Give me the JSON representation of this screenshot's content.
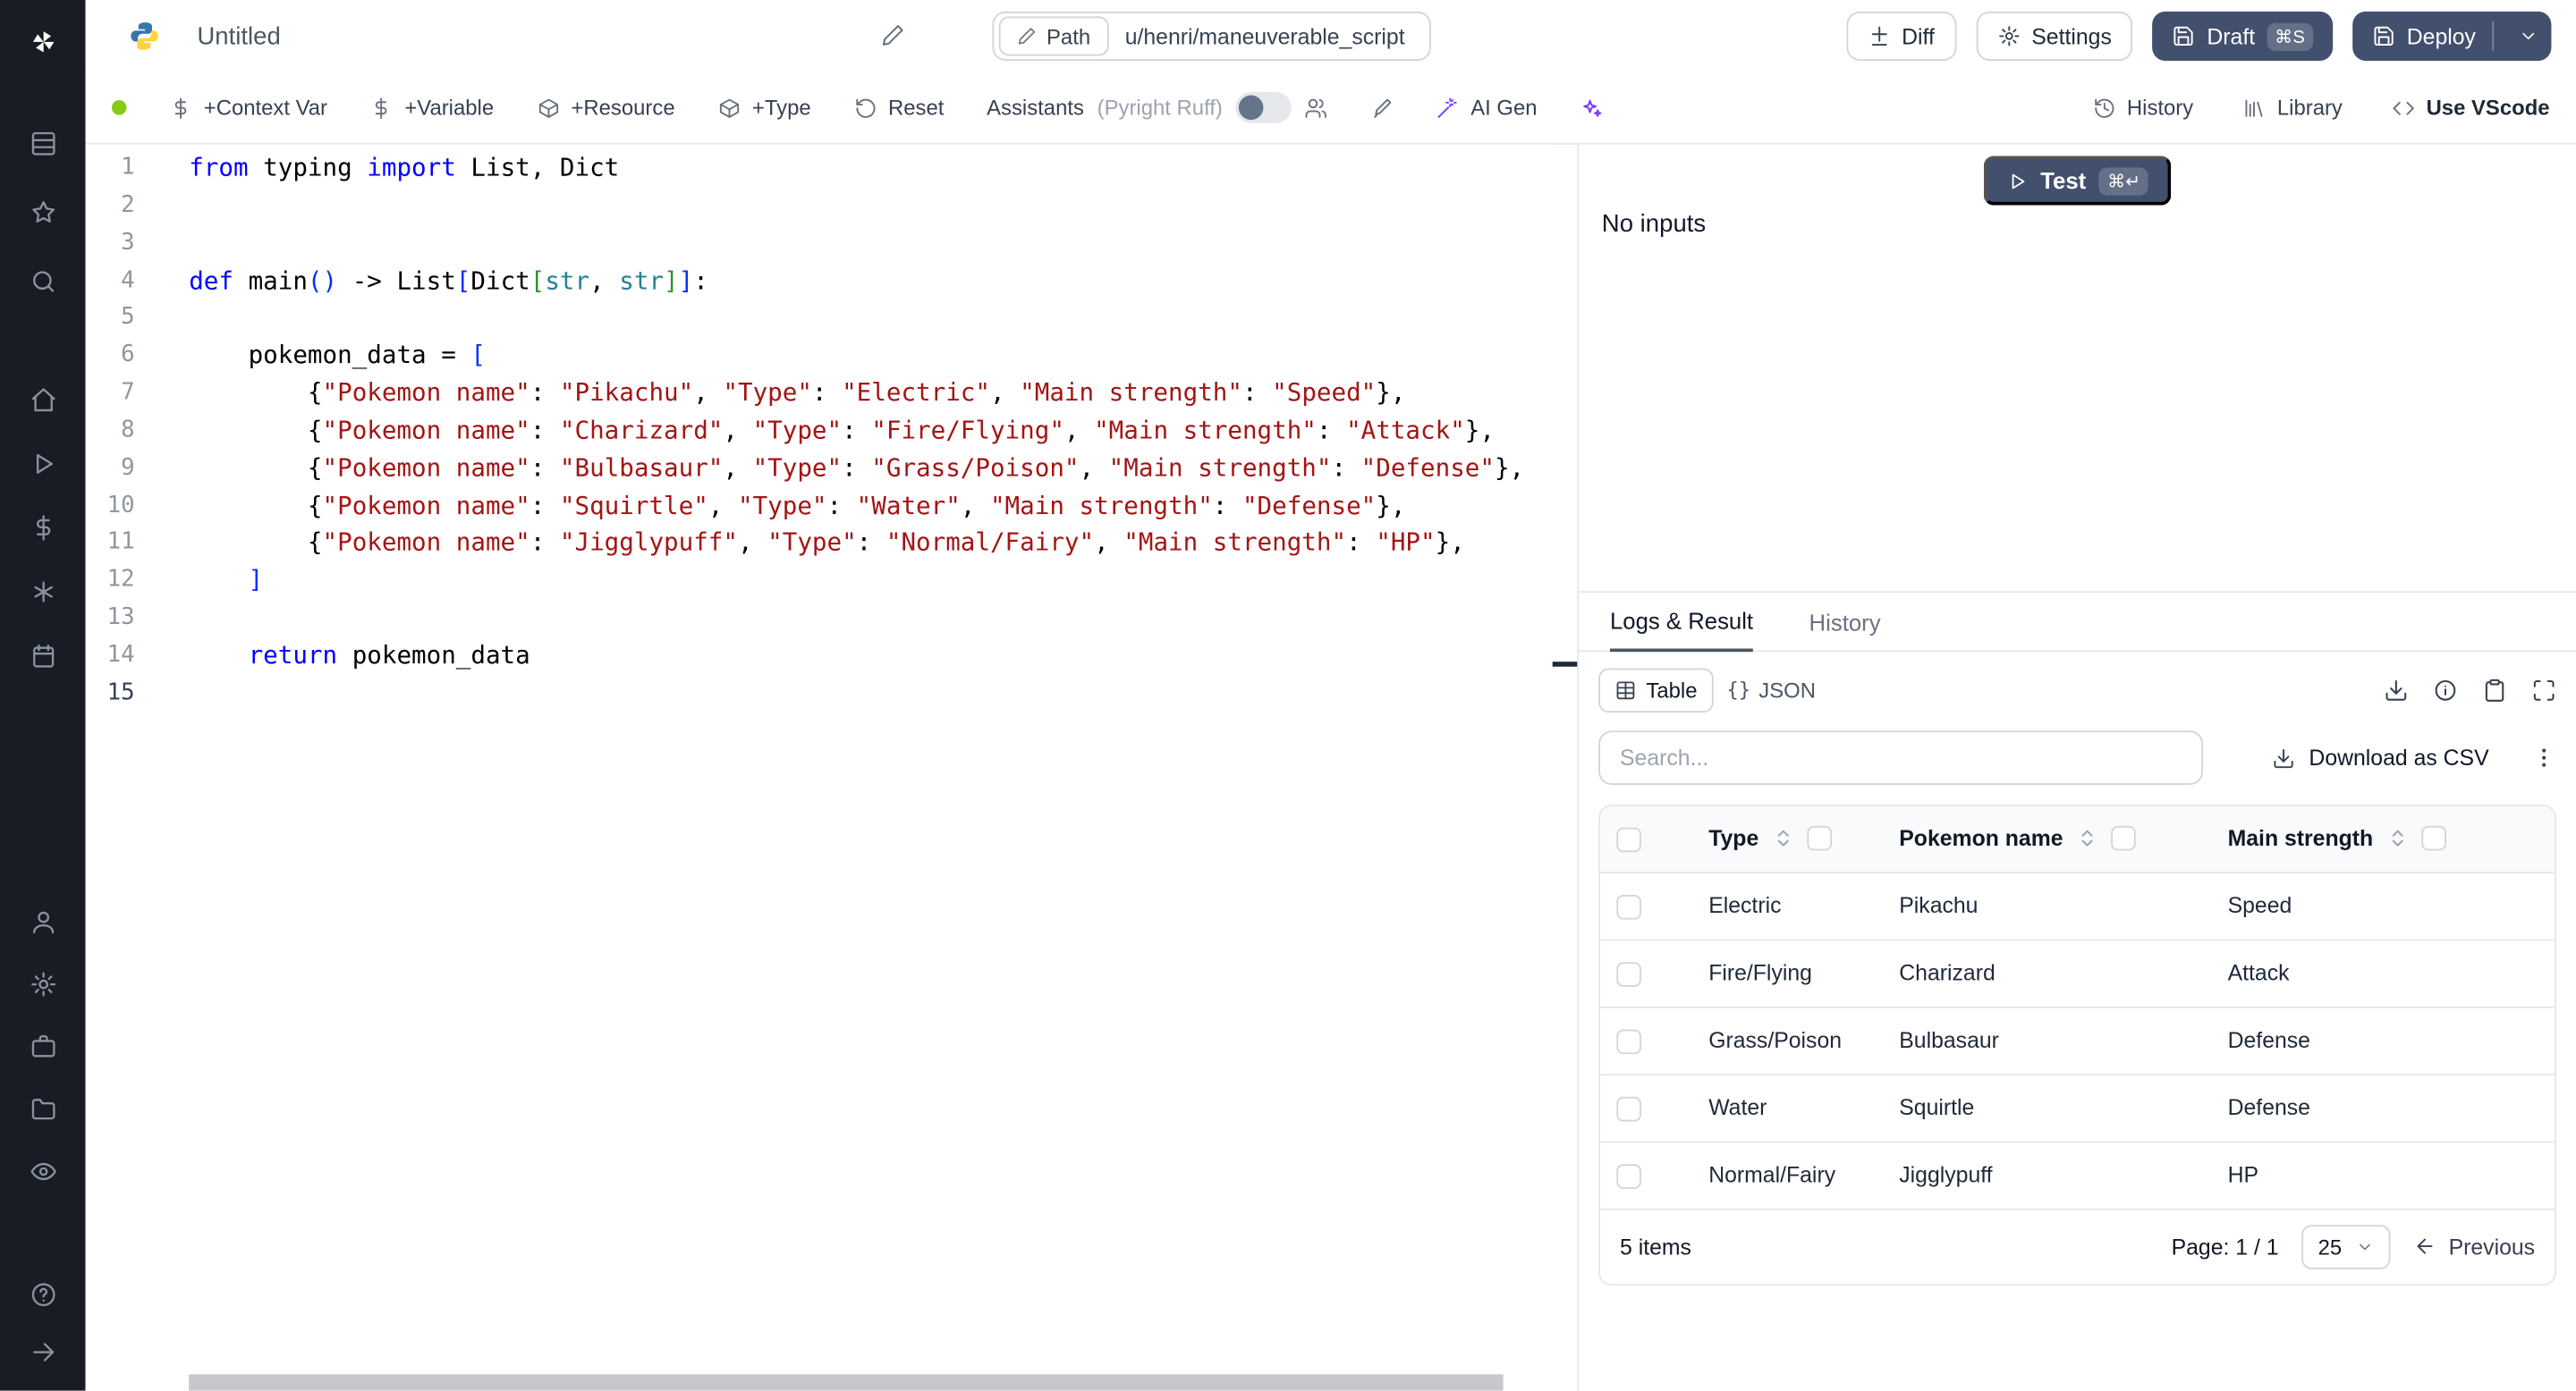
{
  "colors": {
    "sidebar_bg": "#181c24",
    "primary_button": "#42506e",
    "status_green": "#84cc16",
    "code_keyword": "#0000ff",
    "code_string": "#a31515",
    "code_type": "#267f99"
  },
  "topbar": {
    "app_title": "Untitled",
    "path_button": "Path",
    "path_value": "u/henri/maneuverable_script",
    "diff": "Diff",
    "settings": "Settings",
    "draft": "Draft",
    "draft_shortcut": "⌘S",
    "deploy": "Deploy"
  },
  "toolbar": {
    "add_context_var": "+Context Var",
    "add_variable": "+Variable",
    "add_resource": "+Resource",
    "add_type": "+Type",
    "reset": "Reset",
    "assistants": "Assistants",
    "assistants_detail": "(Pyright Ruff)",
    "ai_gen": "AI Gen",
    "history": "History",
    "library": "Library",
    "use_vscode": "Use VScode"
  },
  "sidebar_icons": [
    "windmill-logo",
    "grid",
    "star",
    "search",
    "home",
    "runs",
    "variables",
    "resources",
    "schedules",
    "user",
    "settings",
    "workers",
    "folders",
    "audit",
    "help",
    "expand"
  ],
  "editor": {
    "language": "python",
    "lines": [
      {
        "n": "1",
        "tokens": [
          [
            "from",
            "kw"
          ],
          [
            " typing ",
            "pl"
          ],
          [
            "import",
            "kw"
          ],
          [
            " List, Dict",
            "pl"
          ]
        ]
      },
      {
        "n": "2",
        "tokens": []
      },
      {
        "n": "3",
        "tokens": []
      },
      {
        "n": "4",
        "tokens": [
          [
            "def",
            "kw"
          ],
          [
            " main",
            "pl"
          ],
          [
            "(",
            "b1"
          ],
          [
            ")",
            "b1"
          ],
          [
            " -> List",
            "pl"
          ],
          [
            "[",
            "b1"
          ],
          [
            "Dict",
            "pl"
          ],
          [
            "[",
            "b2"
          ],
          [
            "str",
            "ty"
          ],
          [
            ", ",
            "pl"
          ],
          [
            "str",
            "ty"
          ],
          [
            "]",
            "b2"
          ],
          [
            "]",
            "b1"
          ],
          [
            ":",
            "pl"
          ]
        ]
      },
      {
        "n": "5",
        "tokens": []
      },
      {
        "n": "6",
        "tokens": [
          [
            "    pokemon_data = ",
            "pl"
          ],
          [
            "[",
            "b1"
          ]
        ]
      },
      {
        "n": "7",
        "tokens": [
          [
            "        {",
            "pl"
          ],
          [
            "\"Pokemon name\"",
            "st"
          ],
          [
            ": ",
            "pl"
          ],
          [
            "\"Pikachu\"",
            "st"
          ],
          [
            ", ",
            "pl"
          ],
          [
            "\"Type\"",
            "st"
          ],
          [
            ": ",
            "pl"
          ],
          [
            "\"Electric\"",
            "st"
          ],
          [
            ", ",
            "pl"
          ],
          [
            "\"Main strength\"",
            "st"
          ],
          [
            ": ",
            "pl"
          ],
          [
            "\"Speed\"",
            "st"
          ],
          [
            "},",
            "pl"
          ]
        ]
      },
      {
        "n": "8",
        "tokens": [
          [
            "        {",
            "pl"
          ],
          [
            "\"Pokemon name\"",
            "st"
          ],
          [
            ": ",
            "pl"
          ],
          [
            "\"Charizard\"",
            "st"
          ],
          [
            ", ",
            "pl"
          ],
          [
            "\"Type\"",
            "st"
          ],
          [
            ": ",
            "pl"
          ],
          [
            "\"Fire/Flying\"",
            "st"
          ],
          [
            ", ",
            "pl"
          ],
          [
            "\"Main strength\"",
            "st"
          ],
          [
            ": ",
            "pl"
          ],
          [
            "\"Attack\"",
            "st"
          ],
          [
            "},",
            "pl"
          ]
        ]
      },
      {
        "n": "9",
        "tokens": [
          [
            "        {",
            "pl"
          ],
          [
            "\"Pokemon name\"",
            "st"
          ],
          [
            ": ",
            "pl"
          ],
          [
            "\"Bulbasaur\"",
            "st"
          ],
          [
            ", ",
            "pl"
          ],
          [
            "\"Type\"",
            "st"
          ],
          [
            ": ",
            "pl"
          ],
          [
            "\"Grass/Poison\"",
            "st"
          ],
          [
            ", ",
            "pl"
          ],
          [
            "\"Main strength\"",
            "st"
          ],
          [
            ": ",
            "pl"
          ],
          [
            "\"Defense\"",
            "st"
          ],
          [
            "},",
            "pl"
          ]
        ]
      },
      {
        "n": "10",
        "tokens": [
          [
            "        {",
            "pl"
          ],
          [
            "\"Pokemon name\"",
            "st"
          ],
          [
            ": ",
            "pl"
          ],
          [
            "\"Squirtle\"",
            "st"
          ],
          [
            ", ",
            "pl"
          ],
          [
            "\"Type\"",
            "st"
          ],
          [
            ": ",
            "pl"
          ],
          [
            "\"Water\"",
            "st"
          ],
          [
            ", ",
            "pl"
          ],
          [
            "\"Main strength\"",
            "st"
          ],
          [
            ": ",
            "pl"
          ],
          [
            "\"Defense\"",
            "st"
          ],
          [
            "},",
            "pl"
          ]
        ]
      },
      {
        "n": "11",
        "tokens": [
          [
            "        {",
            "pl"
          ],
          [
            "\"Pokemon name\"",
            "st"
          ],
          [
            ": ",
            "pl"
          ],
          [
            "\"Jigglypuff\"",
            "st"
          ],
          [
            ", ",
            "pl"
          ],
          [
            "\"Type\"",
            "st"
          ],
          [
            ": ",
            "pl"
          ],
          [
            "\"Normal/Fairy\"",
            "st"
          ],
          [
            ", ",
            "pl"
          ],
          [
            "\"Main strength\"",
            "st"
          ],
          [
            ": ",
            "pl"
          ],
          [
            "\"HP\"",
            "st"
          ],
          [
            "},",
            "pl"
          ]
        ]
      },
      {
        "n": "12",
        "tokens": [
          [
            "    ",
            "pl"
          ],
          [
            "]",
            "b1"
          ]
        ]
      },
      {
        "n": "13",
        "tokens": []
      },
      {
        "n": "14",
        "tokens": [
          [
            "    ",
            "pl"
          ],
          [
            "return",
            "kw"
          ],
          [
            " pokemon_data",
            "pl"
          ]
        ]
      },
      {
        "n": "15",
        "tokens": []
      }
    ]
  },
  "runner": {
    "test": "Test",
    "test_shortcut": "⌘↵",
    "no_inputs": "No inputs"
  },
  "results": {
    "tabs": {
      "logs_result": "Logs & Result",
      "history": "History"
    },
    "views": {
      "table": "Table",
      "json": "JSON",
      "json_icon": "{}"
    },
    "search_placeholder": "Search...",
    "download_csv": "Download as CSV",
    "footer": {
      "items": "5 items",
      "page": "Page: 1 / 1",
      "page_size": "25",
      "previous": "Previous"
    }
  },
  "result_table": {
    "columns": [
      "Type",
      "Pokemon name",
      "Main strength"
    ],
    "rows": [
      [
        "Electric",
        "Pikachu",
        "Speed"
      ],
      [
        "Fire/Flying",
        "Charizard",
        "Attack"
      ],
      [
        "Grass/Poison",
        "Bulbasaur",
        "Defense"
      ],
      [
        "Water",
        "Squirtle",
        "Defense"
      ],
      [
        "Normal/Fairy",
        "Jigglypuff",
        "HP"
      ]
    ]
  }
}
